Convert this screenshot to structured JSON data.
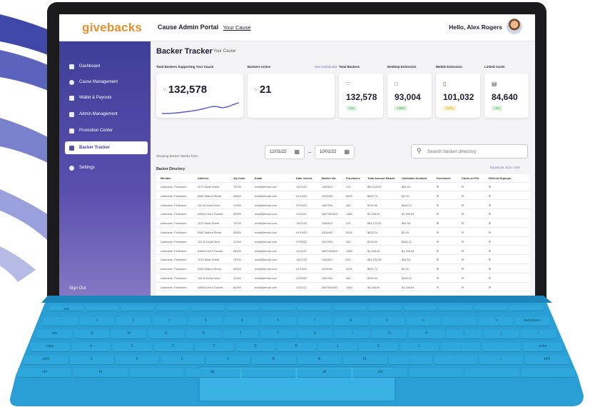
{
  "app": {
    "logo": "givebacks",
    "portal_title": "Cause Admin Portal",
    "portal_cause": "Your Cause",
    "greeting": "Hello, Alex Rogers"
  },
  "sidebar": {
    "items": [
      {
        "label": "Dashboard",
        "icon": "dashboard-icon"
      },
      {
        "label": "Cause Management",
        "icon": "cause-icon"
      },
      {
        "label": "Wallet & Payouts",
        "icon": "wallet-icon"
      },
      {
        "label": "Admin Management",
        "icon": "admin-icon"
      },
      {
        "label": "Promotion Center",
        "icon": "promotion-icon"
      },
      {
        "label": "Backer Tracker",
        "icon": "chart-icon",
        "active": true
      },
      {
        "label": "Settings",
        "icon": "gear-icon"
      }
    ],
    "sign_out": "Sign Out"
  },
  "page": {
    "title": "Backer Tracker",
    "subtitle": "Your Cause",
    "link": "See Dashboard",
    "accent_color": "#3e3f99",
    "brand_color": "#e98f2c"
  },
  "cards": [
    {
      "label": "Total Backers Supporting Your Cause",
      "value": "132,578"
    },
    {
      "label": "Backers Active",
      "value": "21"
    }
  ],
  "small_cards": [
    {
      "label": "Total Backers",
      "icon": "users-icon",
      "value": "132,578",
      "pct": "+4%",
      "pct_color": "green"
    },
    {
      "label": "Desktop Extension",
      "icon": "desktop-icon",
      "value": "93,004",
      "pct": "+28%",
      "pct_color": "green"
    },
    {
      "label": "Mobile Extension",
      "icon": "mobile-icon",
      "value": "101,032",
      "pct": "+12%",
      "pct_color": "yellow"
    },
    {
      "label": "Linked Cards",
      "icon": "card-icon",
      "value": "84,640",
      "pct": "+4%",
      "pct_color": "green"
    }
  ],
  "filters": {
    "showing": "Showing Backer Weeks from:",
    "date_from": "12/01/22",
    "date_to": "10/01/22",
    "search_placeholder": "Search backer directory"
  },
  "table": {
    "title": "Backer Directory",
    "export": "Export as .XLS .CSV",
    "columns": [
      "Member",
      "Address",
      "Zip Code",
      "Email",
      "Date Joined",
      "Backer No.",
      "Purchases",
      "Total Amount Raised",
      "Cashback Donated",
      "Purchases",
      "Cards on File",
      "Referral Signups"
    ],
    "rows": [
      [
        "Lastname, Firstname",
        "1570 State Street",
        "78705",
        "email@email.com",
        "10/21/22",
        "1159402",
        "224",
        "$54,123.00",
        "$54.53"
      ],
      [
        "Lastname, Firstname",
        "5382 Walnut Street",
        "63829",
        "email@email.com",
        "01/19/22",
        "4326402",
        "5325",
        "$832.74",
        "$2.00"
      ],
      [
        "Lastname, Firstname",
        "134 B Duval Drive",
        "12349",
        "email@email.com",
        "07/03/22",
        "1567904",
        "453",
        "$749.00",
        "$445.12"
      ],
      [
        "Lastname, Firstname",
        "5456d Unit 3 Sunset...",
        "84305",
        "email@email.com",
        "11/11/22",
        "456793245G",
        "1380",
        "$1,346.54",
        "$1,346.54"
      ],
      [
        "Lastname, Firstname",
        "1570 State Street",
        "78705",
        "email@email.com",
        "10/21/22",
        "1159402",
        "224",
        "$54,123.00",
        "$54.53"
      ],
      [
        "Lastname, Firstname",
        "5382 Walnut Street",
        "63829",
        "email@email.com",
        "01/19/22",
        "4326402",
        "5325",
        "$832.74",
        "$2.00"
      ],
      [
        "Lastname, Firstname",
        "134 B Duval Drive",
        "12349",
        "email@email.com",
        "07/03/22",
        "1567904",
        "453",
        "$749.00",
        "$445.12"
      ],
      [
        "Lastname, Firstname",
        "5456d Unit 3 Sunset...",
        "84305",
        "email@email.com",
        "11/11/22",
        "456793245G",
        "1380",
        "$1,346.54",
        "$1,346.54"
      ],
      [
        "Lastname, Firstname",
        "1570 State Street",
        "78705",
        "email@email.com",
        "10/21/22",
        "1159402",
        "224",
        "$54,123.00",
        "$54.53"
      ],
      [
        "Lastname, Firstname",
        "5382 Walnut Street",
        "63829",
        "email@email.com",
        "01/19/22",
        "4326402",
        "5325",
        "$832.74",
        "$2.00"
      ],
      [
        "Lastname, Firstname",
        "134 B Duval Drive",
        "12349",
        "email@email.com",
        "07/03/22",
        "1567904",
        "453",
        "$749.00",
        "$445.12"
      ],
      [
        "Lastname, Firstname",
        "5456d Unit 3 Sunset...",
        "84305",
        "email@email.com",
        "11/11/22",
        "456793245G",
        "1380",
        "$1,346.54",
        "$1,346.54"
      ],
      [
        "Lastname, Firstname",
        "1570 State Street",
        "78705",
        "email@email.com",
        "10/21/22",
        "1159402",
        "224",
        "$54,123.00",
        "$54.53"
      ],
      [
        "Lastname, Firstname",
        "5382 Walnut Street",
        "63829",
        "email@email.com",
        "01/19/22",
        "4326402",
        "5325",
        "$832.74",
        "$2.00"
      ]
    ]
  },
  "keyboard": {
    "color": "#2ea7dc",
    "row_labels": [
      [
        "esc",
        "",
        "",
        "",
        "",
        "",
        "",
        "",
        "",
        "",
        "",
        "",
        "",
        ""
      ],
      [
        "~",
        "1",
        "2",
        "3",
        "4",
        "5",
        "6",
        "7",
        "8",
        "9",
        "0",
        "-",
        "=",
        "backspace"
      ],
      [
        "tab",
        "Q",
        "W",
        "E",
        "R",
        "T",
        "Y",
        "U",
        "I",
        "O",
        "P",
        "[",
        "]",
        "\\"
      ],
      [
        "caps",
        "A",
        "S",
        "D",
        "F",
        "G",
        "H",
        "J",
        "K",
        "L",
        ";",
        "'",
        "enter"
      ],
      [
        "shift",
        "Z",
        "X",
        "C",
        "V",
        "B",
        "N",
        "M",
        ",",
        ".",
        "/",
        "shift"
      ],
      [
        "ctrl",
        "fn",
        "",
        "alt",
        "",
        "alt",
        "ctrl",
        "",
        "",
        ""
      ]
    ]
  }
}
